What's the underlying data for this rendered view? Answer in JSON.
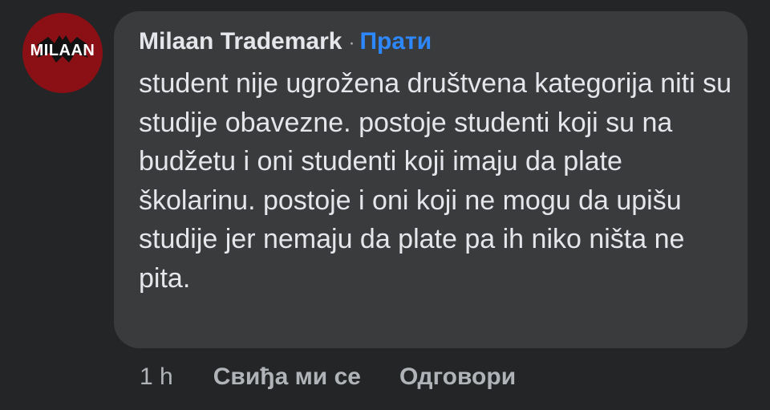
{
  "comment": {
    "avatar_logo_text": "MILAAN",
    "author": "Milaan Trademark",
    "separator": "·",
    "follow_label": "Прати",
    "text": "student nije ugrožena društvena kategorija niti su studije obavezne. postoje studenti koji su na budžetu i oni studenti koji imaju da plate školarinu. postoje i oni koji ne mogu da upišu studije jer nemaju da plate pa ih niko ništa ne pita.",
    "time": "1 h",
    "like_label": "Свиђа ми се",
    "reply_label": "Одговори"
  },
  "colors": {
    "background": "#242526",
    "bubble": "#3a3b3c",
    "primary_text": "#e4e6eb",
    "secondary_text": "#b0b3b8",
    "link": "#2d88ff",
    "avatar_bg": "#8a1015"
  }
}
